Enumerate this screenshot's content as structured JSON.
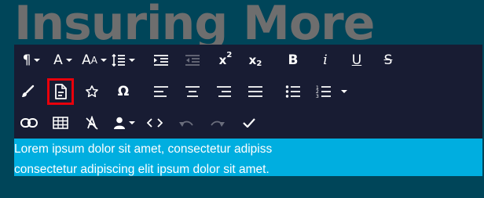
{
  "page": {
    "heading": "Insuring More",
    "content_lines": [
      "Lorem ipsum dolor sit amet, consectetur adipiss",
      "consectetur adipiscing elit ipsum dolor sit amet."
    ]
  },
  "colors": {
    "page_background": "#004559",
    "toolbar_background": "#181c33",
    "content_background": "#00aee0",
    "highlight_outline": "#e8000b",
    "heading_text": "#6e6e6e"
  },
  "toolbar": {
    "row1": [
      {
        "icon": "paragraph-format-icon",
        "glyph": "¶",
        "dropdown": true
      },
      {
        "icon": "font-family-icon",
        "glyph": "A",
        "dropdown": true
      },
      {
        "icon": "font-size-icon",
        "glyph": "AA",
        "dropdown": true
      },
      {
        "icon": "line-height-icon",
        "dropdown": true
      },
      {
        "icon": "indent-icon"
      },
      {
        "icon": "outdent-icon",
        "disabled": true
      },
      {
        "icon": "superscript-icon",
        "glyph": "x²"
      },
      {
        "icon": "subscript-icon",
        "glyph": "x₂"
      },
      {
        "icon": "bold-icon",
        "glyph": "B"
      },
      {
        "icon": "italic-icon",
        "glyph": "i"
      },
      {
        "icon": "underline-icon",
        "glyph": "U"
      },
      {
        "icon": "strikethrough-icon",
        "glyph": "S"
      }
    ],
    "row2": [
      {
        "icon": "clear-formatting-brush-icon"
      },
      {
        "icon": "document-icon",
        "highlighted": true
      },
      {
        "icon": "star-icon"
      },
      {
        "icon": "special-characters-omega-icon",
        "glyph": "Ω"
      },
      {
        "icon": "align-left-icon"
      },
      {
        "icon": "align-center-icon"
      },
      {
        "icon": "align-right-icon"
      },
      {
        "icon": "align-justify-icon"
      },
      {
        "icon": "unordered-list-icon"
      },
      {
        "icon": "ordered-list-icon",
        "dropdown": true
      }
    ],
    "row3": [
      {
        "icon": "link-icon"
      },
      {
        "icon": "table-icon"
      },
      {
        "icon": "clear-format-icon"
      },
      {
        "icon": "user-icon",
        "dropdown": true
      },
      {
        "icon": "code-view-icon"
      },
      {
        "icon": "undo-icon",
        "disabled": true
      },
      {
        "icon": "redo-icon",
        "disabled": true
      },
      {
        "icon": "checkmark-icon"
      }
    ]
  }
}
